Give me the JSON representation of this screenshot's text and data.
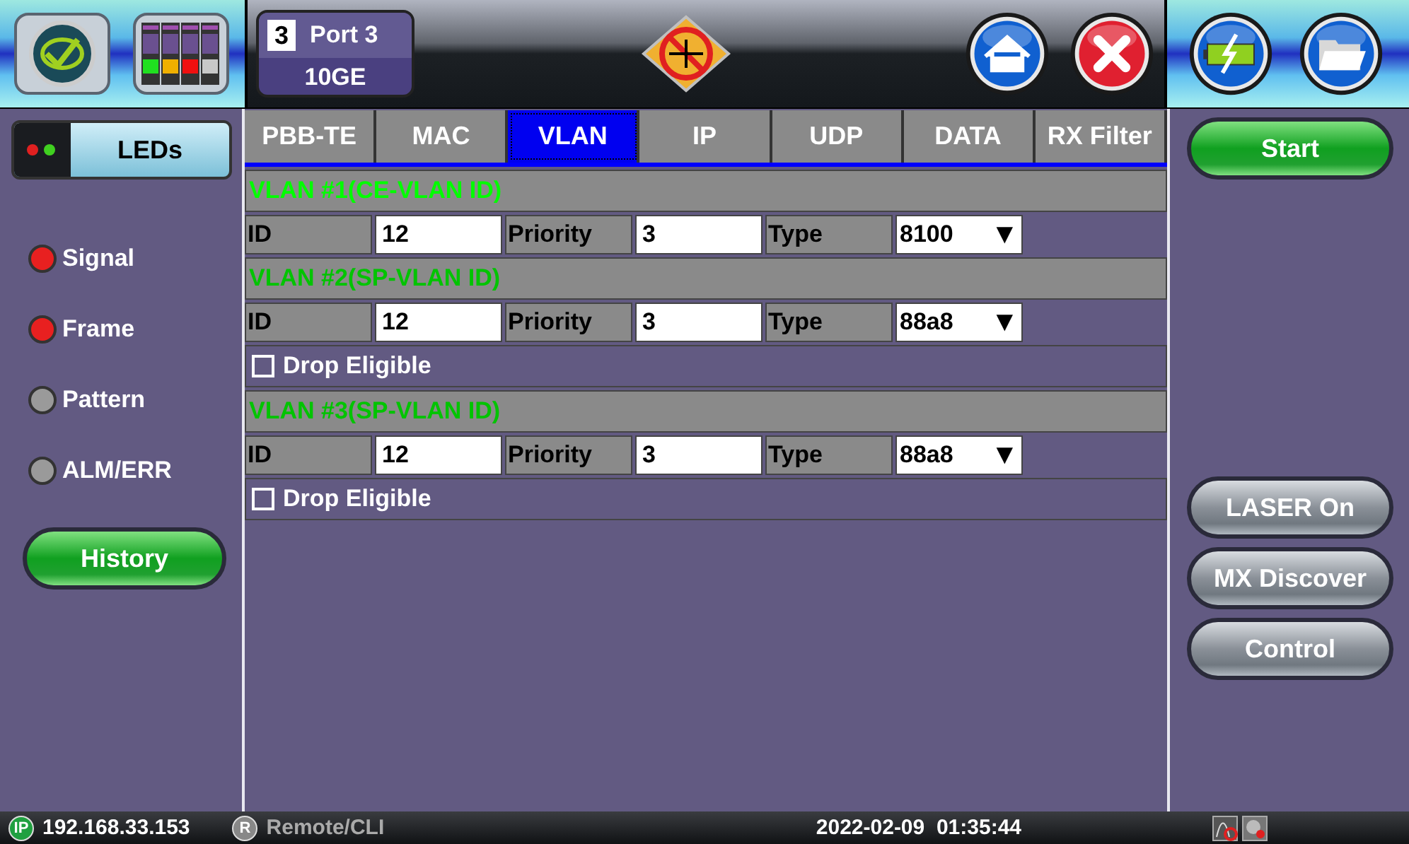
{
  "port": {
    "number": "3",
    "name": "Port 3",
    "rate": "10GE"
  },
  "leds_button": {
    "label": "LEDs"
  },
  "leds": [
    {
      "label": "Signal",
      "color": "#e82020"
    },
    {
      "label": "Frame",
      "color": "#e82020"
    },
    {
      "label": "Pattern",
      "color": "#9a9a9a"
    },
    {
      "label": "ALM/ERR",
      "color": "#9a9a9a"
    }
  ],
  "history_button": {
    "label": "History"
  },
  "tabs": [
    {
      "label": "PBB-TE",
      "selected": false
    },
    {
      "label": "MAC",
      "selected": false
    },
    {
      "label": "VLAN",
      "selected": true
    },
    {
      "label": "IP",
      "selected": false
    },
    {
      "label": "UDP",
      "selected": false
    },
    {
      "label": "DATA",
      "selected": false
    },
    {
      "label": "RX Filter",
      "selected": false
    }
  ],
  "vlans": [
    {
      "title": "VLAN #1(CE-VLAN ID)",
      "color": "#00ff00",
      "id_label": "ID",
      "id": "12",
      "priority_label": "Priority",
      "priority": "3",
      "type_label": "Type",
      "type": "8100",
      "arrow": "▼"
    },
    {
      "title": "VLAN #2(SP-VLAN ID)",
      "color": "#00c400",
      "id_label": "ID",
      "id": "12",
      "priority_label": "Priority",
      "priority": "3",
      "type_label": "Type",
      "type": "88a8",
      "arrow": "▼",
      "drop_eligible": {
        "label": "Drop Eligible",
        "checked": false
      }
    },
    {
      "title": "VLAN #3(SP-VLAN ID)",
      "color": "#00c400",
      "id_label": "ID",
      "id": "12",
      "priority_label": "Priority",
      "priority": "3",
      "type_label": "Type",
      "type": "88a8",
      "arrow": "▼",
      "drop_eligible": {
        "label": "Drop Eligible",
        "checked": false
      }
    }
  ],
  "right_buttons": [
    {
      "label": "Start",
      "kind": "primary"
    },
    {
      "label": "LASER On",
      "kind": "secondary"
    },
    {
      "label": "MX Discover",
      "kind": "secondary"
    },
    {
      "label": "Control",
      "kind": "secondary"
    }
  ],
  "status_bar": {
    "ip_badge": "IP",
    "ip": "192.168.33.153",
    "remote_badge": "R",
    "remote": "Remote/CLI",
    "datetime": "2022-02-09  01:35:44"
  }
}
